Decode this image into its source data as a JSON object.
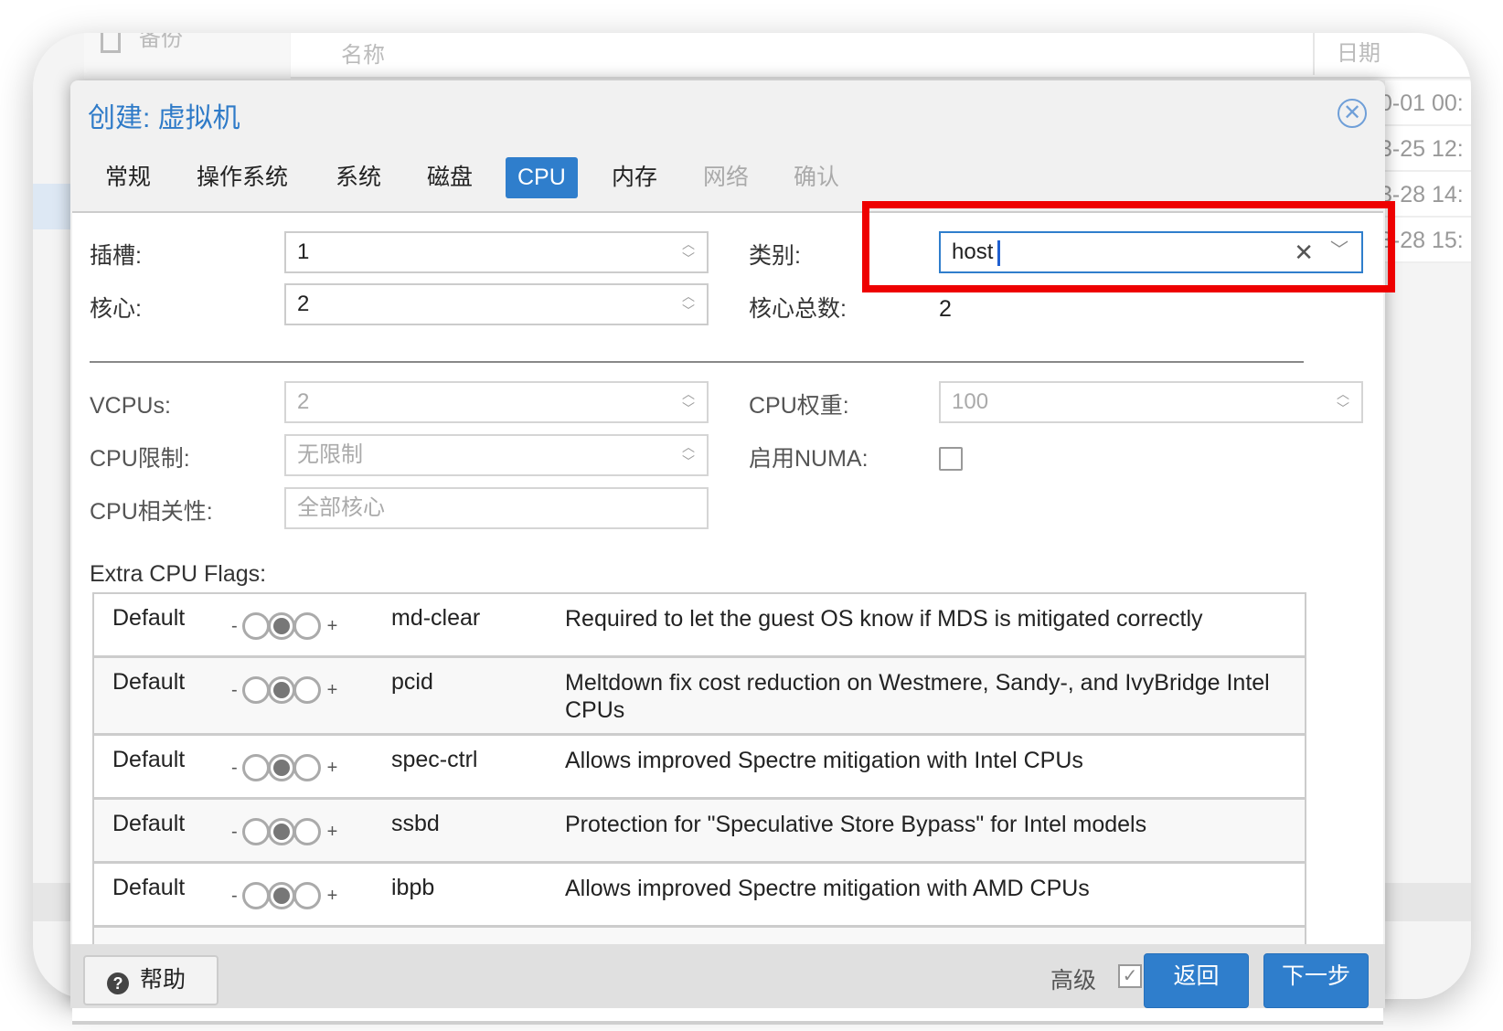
{
  "background": {
    "sidebar_item": "备份",
    "columns": [
      "名称",
      "日期"
    ],
    "dates": [
      "0-01 00:",
      "3-25 12:",
      "3-28 14:",
      "3-28 15:"
    ]
  },
  "dialog": {
    "title": "创建: 虚拟机",
    "tabs": [
      {
        "label": "常规",
        "state": "normal"
      },
      {
        "label": "操作系统",
        "state": "normal"
      },
      {
        "label": "系统",
        "state": "normal"
      },
      {
        "label": "磁盘",
        "state": "normal"
      },
      {
        "label": "CPU",
        "state": "active"
      },
      {
        "label": "内存",
        "state": "normal"
      },
      {
        "label": "网络",
        "state": "disabled"
      },
      {
        "label": "确认",
        "state": "disabled"
      }
    ],
    "form": {
      "sockets_label": "插槽:",
      "sockets_value": "1",
      "cores_label": "核心:",
      "cores_value": "2",
      "type_label": "类别:",
      "type_value": "host",
      "total_cores_label": "核心总数:",
      "total_cores_value": "2",
      "vcpus_label": "VCPUs:",
      "vcpus_placeholder": "2",
      "cpu_units_label": "CPU权重:",
      "cpu_units_placeholder": "100",
      "cpu_limit_label": "CPU限制:",
      "cpu_limit_placeholder": "无限制",
      "numa_label": "启用NUMA:",
      "numa_checked": false,
      "affinity_label": "CPU相关性:",
      "affinity_placeholder": "全部核心"
    },
    "flags_label": "Extra CPU Flags:",
    "flags": [
      {
        "state": "Default",
        "name": "md-clear",
        "desc": "Required to let the guest OS know if MDS is mitigated correctly"
      },
      {
        "state": "Default",
        "name": "pcid",
        "desc": "Meltdown fix cost reduction on Westmere, Sandy-, and IvyBridge Intel CPUs"
      },
      {
        "state": "Default",
        "name": "spec-ctrl",
        "desc": "Allows improved Spectre mitigation with Intel CPUs"
      },
      {
        "state": "Default",
        "name": "ssbd",
        "desc": "Protection for \"Speculative Store Bypass\" for Intel models"
      },
      {
        "state": "Default",
        "name": "ibpb",
        "desc": "Allows improved Spectre mitigation with AMD CPUs"
      }
    ],
    "toggle_minus": "-",
    "toggle_plus": "+",
    "footer": {
      "help": "帮助",
      "advanced": "高级",
      "advanced_checked": true,
      "back": "返回",
      "next": "下一步"
    }
  },
  "colors": {
    "accent": "#2f7ecc",
    "highlight": "#ee0000"
  }
}
